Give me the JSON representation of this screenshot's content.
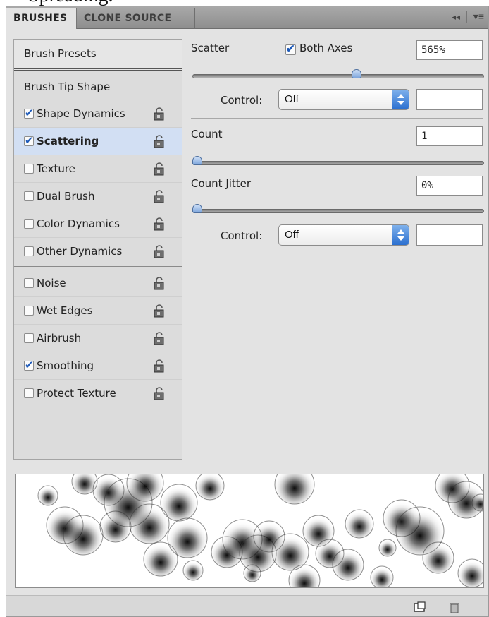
{
  "crop_text": "Spreading.",
  "tabs": {
    "active": "BRUSHES",
    "inactive": "CLONE SOURCE"
  },
  "tabbar": {
    "collapse_glyph": "◂◂",
    "menu_glyph": "▾≡"
  },
  "left": {
    "presets": "Brush Presets",
    "tip_shape": "Brush Tip Shape",
    "options": [
      {
        "label": "Shape Dynamics",
        "checked": true
      },
      {
        "label": "Scattering",
        "checked": true,
        "selected": true
      },
      {
        "label": "Texture",
        "checked": false
      },
      {
        "label": "Dual Brush",
        "checked": false
      },
      {
        "label": "Color Dynamics",
        "checked": false
      },
      {
        "label": "Other Dynamics",
        "checked": false
      },
      {
        "label": "Noise",
        "checked": false
      },
      {
        "label": "Wet Edges",
        "checked": false
      },
      {
        "label": "Airbrush",
        "checked": false
      },
      {
        "label": "Smoothing",
        "checked": true
      },
      {
        "label": "Protect Texture",
        "checked": false
      }
    ]
  },
  "right": {
    "scatter": {
      "label": "Scatter",
      "both_axes_label": "Both Axes",
      "both_axes_checked": true,
      "value": "565%",
      "slider_fraction": 0.565
    },
    "control1": {
      "label": "Control:",
      "value": "Off",
      "field": ""
    },
    "count": {
      "label": "Count",
      "value": "1",
      "slider_fraction": 0.0
    },
    "count_jitter": {
      "label": "Count Jitter",
      "value": "0%",
      "slider_fraction": 0.0
    },
    "control2": {
      "label": "Control:",
      "value": "Off",
      "field": ""
    }
  },
  "footer": {
    "icons": [
      "create-new-brush-icon",
      "trash-icon"
    ]
  },
  "colors": {
    "accent": "#2a6fd0",
    "panel_bg": "#e3e3e3",
    "selected_row": "#d2dff3"
  }
}
